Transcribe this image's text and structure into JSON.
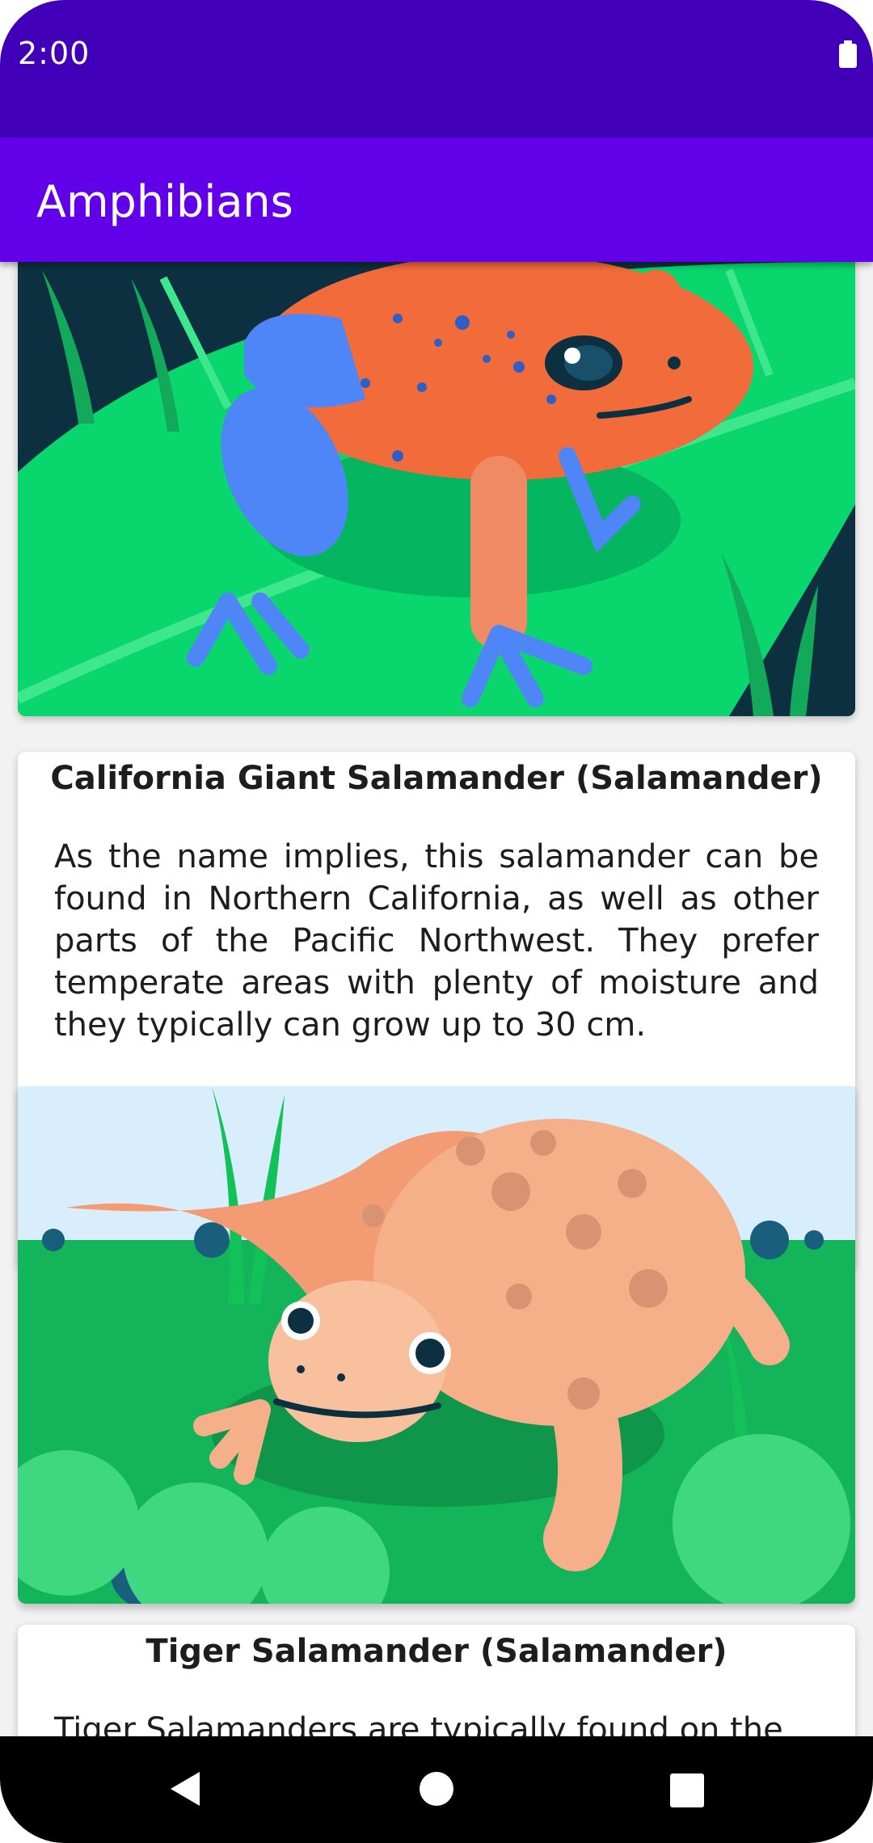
{
  "status_bar": {
    "time": "2:00"
  },
  "app_bar": {
    "title": "Amphibians"
  },
  "cards": [
    {
      "title": "",
      "description": "",
      "image_icon": "poison-dart-frog-illustration"
    },
    {
      "title": "California Giant Salamander (Salamander)",
      "description": "As the name implies, this salamander can be found in Northern California, as well as other parts of the Pacific Northwest. They prefer temperate areas with plenty of moisture and they typically can grow up to 30 cm.",
      "image_icon": "giant-salamander-illustration"
    },
    {
      "title": "Tiger Salamander (Salamander)",
      "description": "Tiger Salamanders are typically found on the"
    }
  ],
  "nav_bar": {
    "icons": [
      "back-icon",
      "home-icon",
      "recents-icon"
    ]
  },
  "colors": {
    "status_bar": "#4100b7",
    "app_bar": "#6200ea",
    "frog_body": "#f26b3a",
    "frog_blue": "#4f86f7",
    "leaf": "#0ad66e",
    "salamander": "#f6b089",
    "grass": "#14b45a"
  }
}
